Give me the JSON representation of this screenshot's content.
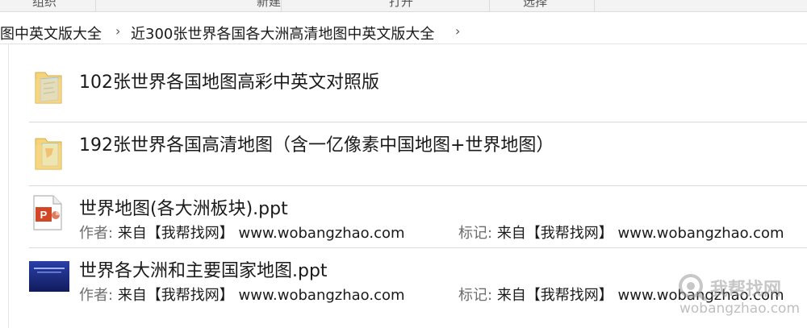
{
  "ribbon": {
    "groups": [
      "组织",
      "新建",
      "打开",
      "选择"
    ]
  },
  "breadcrumb": {
    "items": [
      "图中英文版大全",
      "近300张世界各国各大洲高清地图中英文版大全"
    ],
    "separator": "›"
  },
  "files": [
    {
      "name": "102张世界各国地图高彩中英文对照版",
      "type": "folder"
    },
    {
      "name": "192张世界各国高清地图（含一亿像素中国地图+世界地图）",
      "type": "folder"
    },
    {
      "name": "世界地图(各大洲板块).ppt",
      "type": "ppt",
      "author_label": "作者:",
      "author_value": "来自【我帮找网】 www.wobangzhao.com",
      "tag_label": "标记:",
      "tag_value": "来自【我帮找网】 www.wobangzhao.com"
    },
    {
      "name": "世界各大洲和主要国家地图.ppt",
      "type": "ppt-thumb",
      "author_label": "作者:",
      "author_value": "来自【我帮找网】 www.wobangzhao.com",
      "tag_label": "标记:",
      "tag_value": "来自【我帮找网】 www.wobangzhao.com"
    }
  ],
  "watermark": {
    "line1": "我帮找网",
    "line2": "wobangzhao.com"
  },
  "colors": {
    "folder": "#f5d37a",
    "ppt": "#d24726",
    "divider": "#d9d9d9"
  }
}
